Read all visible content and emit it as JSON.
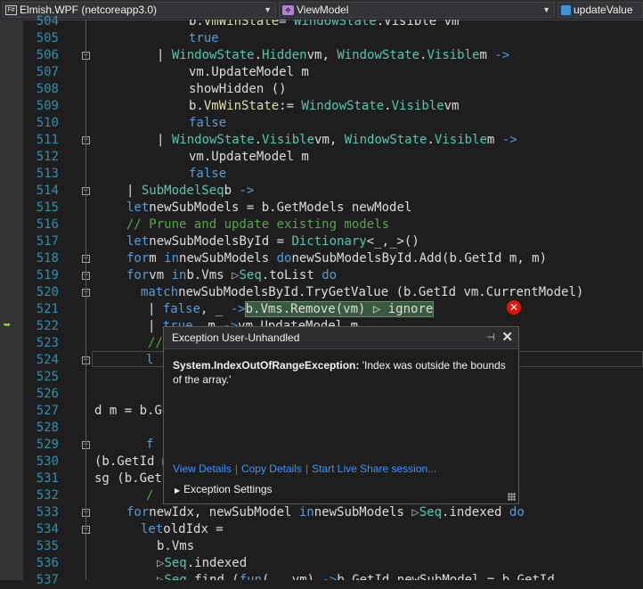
{
  "navbar": {
    "project": "Elmish.WPF (netcoreapp3.0)",
    "type": "ViewModel",
    "member": "updateValue"
  },
  "lines": [
    {
      "n": "504",
      "segs": [
        [
          "",
          "    b."
        ],
        [
          "vm",
          "VmWinState"
        ],
        [
          "",
          " = "
        ],
        [
          "ty",
          "WindowState"
        ],
        [
          "",
          ".Visible vm"
        ]
      ]
    },
    {
      "n": "505",
      "segs": [
        [
          "",
          "        "
        ],
        [
          "kw",
          "true"
        ]
      ]
    },
    {
      "n": "506",
      "segs": [
        [
          "",
          "  | "
        ],
        [
          "ty",
          "WindowState"
        ],
        [
          "",
          "."
        ],
        [
          "ty",
          "Hidden"
        ],
        [
          "",
          " vm, "
        ],
        [
          "ty",
          "WindowState"
        ],
        [
          "",
          "."
        ],
        [
          "ty",
          "Visible"
        ],
        [
          "",
          " m "
        ],
        [
          "kw",
          "->"
        ]
      ]
    },
    {
      "n": "507",
      "segs": [
        [
          "",
          "      vm.UpdateModel m"
        ]
      ]
    },
    {
      "n": "508",
      "segs": [
        [
          "",
          "      showHidden ()"
        ]
      ]
    },
    {
      "n": "509",
      "segs": [
        [
          "",
          "      b."
        ],
        [
          "vm",
          "VmWinState"
        ],
        [
          "",
          " := "
        ],
        [
          "ty",
          "WindowState"
        ],
        [
          "",
          "."
        ],
        [
          "ty",
          "Visible"
        ],
        [
          "",
          " vm"
        ]
      ]
    },
    {
      "n": "510",
      "segs": [
        [
          "",
          "      "
        ],
        [
          "kw",
          "false"
        ]
      ]
    },
    {
      "n": "511",
      "segs": [
        [
          "",
          "  | "
        ],
        [
          "ty",
          "WindowState"
        ],
        [
          "",
          "."
        ],
        [
          "ty",
          "Visible"
        ],
        [
          "",
          " vm, "
        ],
        [
          "ty",
          "WindowState"
        ],
        [
          "",
          "."
        ],
        [
          "ty",
          "Visible"
        ],
        [
          "",
          " m "
        ],
        [
          "kw",
          "->"
        ]
      ]
    },
    {
      "n": "512",
      "segs": [
        [
          "",
          "      vm.UpdateModel m"
        ]
      ]
    },
    {
      "n": "513",
      "segs": [
        [
          "",
          "      "
        ],
        [
          "kw",
          "false"
        ]
      ]
    },
    {
      "n": "514",
      "segs": [
        [
          "",
          "| "
        ],
        [
          "ty",
          "SubModelSeq"
        ],
        [
          "",
          " b "
        ],
        [
          "kw",
          "->"
        ]
      ]
    },
    {
      "n": "515",
      "segs": [
        [
          "",
          "    "
        ],
        [
          "kw",
          "let"
        ],
        [
          "",
          " newSubModels = b.GetModels newModel"
        ]
      ]
    },
    {
      "n": "516",
      "segs": [
        [
          "",
          "    "
        ],
        [
          "cm",
          "// Prune and update existing models"
        ]
      ]
    },
    {
      "n": "517",
      "segs": [
        [
          "",
          "    "
        ],
        [
          "kw",
          "let"
        ],
        [
          "",
          " newSubModelsById = "
        ],
        [
          "ty",
          "Dictionary"
        ],
        [
          "",
          "<_,_>()"
        ]
      ]
    },
    {
      "n": "518",
      "segs": [
        [
          "",
          "    "
        ],
        [
          "kw",
          "for"
        ],
        [
          "",
          " m "
        ],
        [
          "kw",
          "in"
        ],
        [
          "",
          " newSubModels "
        ],
        [
          "kw",
          "do"
        ],
        [
          "",
          " newSubModelsById.Add(b.GetId m, m)"
        ]
      ]
    },
    {
      "n": "519",
      "segs": [
        [
          "",
          "    "
        ],
        [
          "kw",
          "for"
        ],
        [
          "",
          " vm "
        ],
        [
          "kw",
          "in"
        ],
        [
          "",
          " b.Vms "
        ],
        [
          "pipe",
          "▷"
        ],
        [
          "",
          " "
        ],
        [
          "ty",
          "Seq"
        ],
        [
          "",
          ".toList "
        ],
        [
          "kw",
          "do"
        ]
      ]
    },
    {
      "n": "520",
      "segs": [
        [
          "",
          "      "
        ],
        [
          "kw",
          "match"
        ],
        [
          "",
          " newSubModelsById.TryGetValue (b.GetId vm.CurrentModel)"
        ]
      ]
    },
    {
      "n": "521",
      "segs": [
        [
          "",
          "      | "
        ],
        [
          "kw",
          "false"
        ],
        [
          "",
          ", _ "
        ],
        [
          "kw",
          "->"
        ],
        [
          "",
          " "
        ],
        [
          "hl",
          "b.Vms.Remove(vm) ▷ ignore"
        ]
      ]
    },
    {
      "n": "522",
      "segs": [
        [
          "",
          "      | "
        ],
        [
          "kw",
          "true"
        ],
        [
          "",
          ", m "
        ],
        [
          "kw",
          "->"
        ],
        [
          "",
          " vm.UpdateModel m"
        ]
      ]
    },
    {
      "n": "523",
      "segs": [
        [
          "",
          "    "
        ],
        [
          "cm",
          "// ..."
        ]
      ]
    },
    {
      "n": "524",
      "segs": [
        [
          "",
          "    "
        ],
        [
          "kw",
          "l"
        ]
      ]
    },
    {
      "n": "526",
      "segs": [
        [
          "",
          ""
        ]
      ]
    },
    {
      "n": "527",
      "segs": [
        [
          "",
          "                                            d m = b.GetId vm"
        ]
      ]
    },
    {
      "n": "528",
      "segs": [
        [
          "",
          ""
        ]
      ]
    },
    {
      "n": "529",
      "segs": [
        [
          "",
          "    "
        ],
        [
          "kw",
          "f"
        ]
      ]
    },
    {
      "n": "530",
      "segs": [
        [
          "",
          "                                              (b.GetId m "
        ],
        [
          "pipe",
          "▷"
        ],
        [
          "",
          " s"
        ]
      ]
    },
    {
      "n": "531",
      "segs": [
        [
          "",
          "                                             sg (b.GetId m, m"
        ]
      ]
    },
    {
      "n": "532",
      "segs": [
        [
          "",
          "    "
        ],
        [
          "cm",
          "/"
        ]
      ]
    },
    {
      "n": "533",
      "segs": [
        [
          "",
          "    "
        ],
        [
          "kw",
          "for"
        ],
        [
          "",
          " newIdx, newSubModel "
        ],
        [
          "kw",
          "in"
        ],
        [
          "",
          " newSubModels "
        ],
        [
          "pipe",
          "▷"
        ],
        [
          "",
          " "
        ],
        [
          "ty",
          "Seq"
        ],
        [
          "",
          ".indexed "
        ],
        [
          "kw",
          "do"
        ]
      ]
    },
    {
      "n": "534",
      "segs": [
        [
          "",
          "      "
        ],
        [
          "kw",
          "let"
        ],
        [
          "",
          " oldIdx ="
        ]
      ]
    },
    {
      "n": "535",
      "segs": [
        [
          "",
          "        b.Vms"
        ]
      ]
    },
    {
      "n": "536",
      "segs": [
        [
          "",
          "        "
        ],
        [
          "pipe",
          "▷"
        ],
        [
          "",
          " "
        ],
        [
          "ty",
          "Seq"
        ],
        [
          "",
          ".indexed"
        ]
      ]
    },
    {
      "n": "537",
      "segs": [
        [
          "",
          "        "
        ],
        [
          "pipe",
          "▷"
        ],
        [
          "",
          " "
        ],
        [
          "ty",
          "Seq"
        ],
        [
          "",
          ".find ("
        ],
        [
          "kw",
          "fun"
        ],
        [
          "",
          " (_, vm) "
        ],
        [
          "kw",
          "->"
        ],
        [
          "",
          " b.GetId newSubModel = b.GetId"
        ]
      ]
    }
  ],
  "extra_line_numbers": [
    "525"
  ],
  "popup": {
    "title": "Exception User-Unhandled",
    "pin": "⊣",
    "close": "✕",
    "exception_type": "System.IndexOutOfRangeException:",
    "exception_msg": " 'Index was outside the bounds of the array.'",
    "link_view": "View Details",
    "link_copy": "Copy Details",
    "link_share": "Start Live Share session...",
    "settings": "Exception Settings"
  }
}
